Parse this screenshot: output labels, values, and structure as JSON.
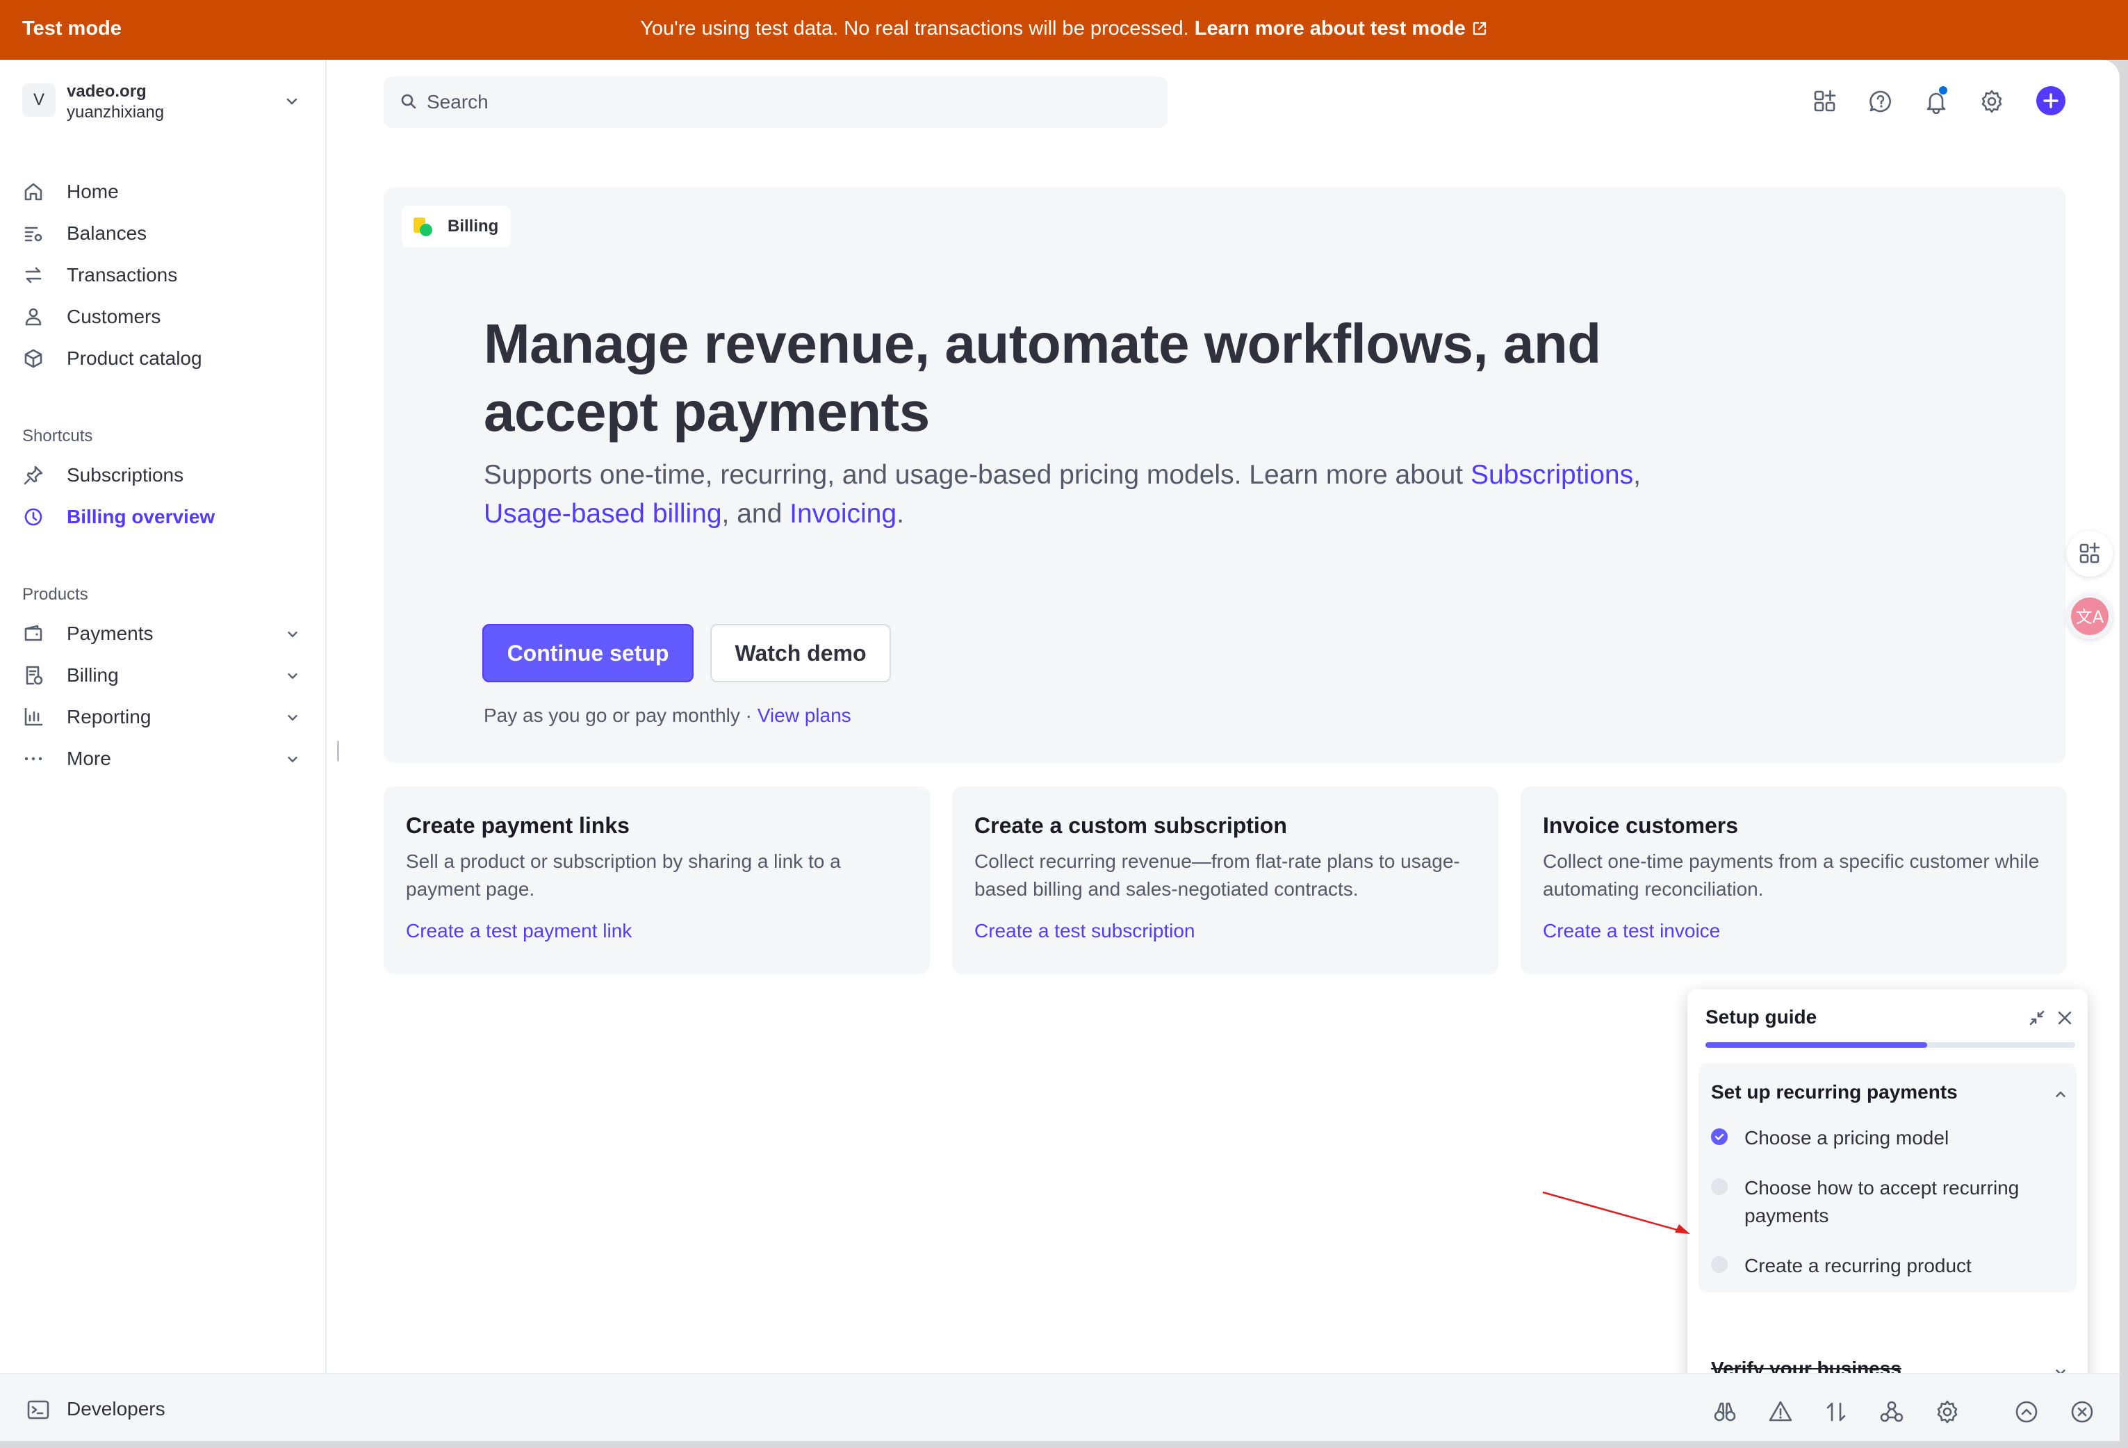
{
  "banner": {
    "mode": "Test mode",
    "message": "You're using test data. No real transactions will be processed.",
    "link": "Learn more about test mode",
    "color": "#cc4b00"
  },
  "account": {
    "initial": "V",
    "org": "vadeo.org",
    "user": "yuanzhixiang"
  },
  "nav": {
    "home": "Home",
    "balances": "Balances",
    "transactions": "Transactions",
    "customers": "Customers",
    "product_catalog": "Product catalog"
  },
  "shortcuts": {
    "title": "Shortcuts",
    "subscriptions": "Subscriptions",
    "billing_overview": "Billing overview"
  },
  "products": {
    "title": "Products",
    "payments": "Payments",
    "billing": "Billing",
    "reporting": "Reporting",
    "more": "More"
  },
  "search": {
    "placeholder": "Search"
  },
  "hero": {
    "chip": "Billing",
    "title": "Manage revenue, automate workflows, and accept payments",
    "sub_prefix": "Supports one-time, recurring, and usage-based pricing models. Learn more about ",
    "link_subscriptions": "Subscriptions",
    "sep_comma": ",",
    "link_usage": "Usage-based billing",
    "sep_and": ", and ",
    "link_invoicing": "Invoicing",
    "sep_period": ".",
    "continue_label": "Continue setup",
    "demo_label": "Watch demo",
    "plans_text": "Pay as you go or pay monthly · ",
    "plans_link": "View plans"
  },
  "cards": [
    {
      "title": "Create payment links",
      "desc": "Sell a product or subscription by sharing a link to a payment page.",
      "link": "Create a test payment link"
    },
    {
      "title": "Create a custom subscription",
      "desc": "Collect recurring revenue—from flat-rate plans to usage-based billing and sales-negotiated contracts.",
      "link": "Create a test subscription"
    },
    {
      "title": "Invoice customers",
      "desc": "Collect one-time payments from a specific customer while automating reconciliation.",
      "link": "Create a test invoice"
    }
  ],
  "guide": {
    "title": "Setup guide",
    "progress": 0.6,
    "section_title": "Set up recurring payments",
    "tasks": [
      {
        "label": "Choose a pricing model",
        "done": true
      },
      {
        "label": "Choose how to accept recurring payments",
        "done": false
      },
      {
        "label": "Create a recurring product",
        "done": false
      }
    ],
    "verify": "Verify your business"
  },
  "devbar": {
    "label": "Developers"
  },
  "accent": "#533afd"
}
